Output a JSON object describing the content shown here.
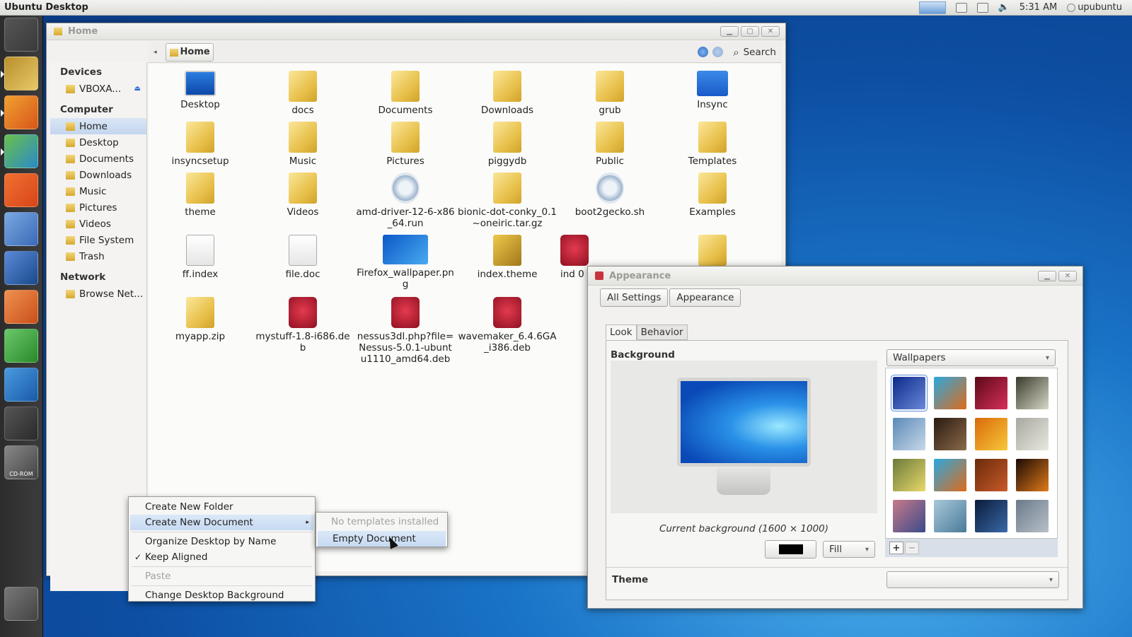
{
  "topbar": {
    "title": "Ubuntu Desktop",
    "time": "5:31 AM",
    "user": "upubuntu"
  },
  "launcher": {
    "icons": [
      "ubuntu-logo-icon",
      "files-icon",
      "firefox-icon",
      "image-viewer-icon",
      "software-center-icon",
      "system-settings-icon",
      "writer-icon",
      "impress-icon",
      "calc-icon",
      "display-icon",
      "workspaces-icon",
      "cdrom-icon",
      "trash-icon"
    ],
    "cdrom_label": "CD-ROM"
  },
  "files": {
    "title": "Home",
    "sidebar": {
      "devices_heading": "Devices",
      "device": "VBOXA...",
      "computer_heading": "Computer",
      "computer_items": [
        "Home",
        "Desktop",
        "Documents",
        "Downloads",
        "Music",
        "Pictures",
        "Videos",
        "File System",
        "Trash"
      ],
      "network_heading": "Network",
      "network_item": "Browse Net..."
    },
    "path": "Home",
    "search": "Search",
    "items": [
      {
        "name": "Desktop",
        "kind": "monitor"
      },
      {
        "name": "docs",
        "kind": "folder"
      },
      {
        "name": "Documents",
        "kind": "folder"
      },
      {
        "name": "Downloads",
        "kind": "folder"
      },
      {
        "name": "grub",
        "kind": "folder"
      },
      {
        "name": "Insync",
        "kind": "insync"
      },
      {
        "name": "insyncsetup",
        "kind": "folder"
      },
      {
        "name": "Music",
        "kind": "folder"
      },
      {
        "name": "Pictures",
        "kind": "folder"
      },
      {
        "name": "piggydb",
        "kind": "folder"
      },
      {
        "name": "Public",
        "kind": "folder"
      },
      {
        "name": "Templates",
        "kind": "folder"
      },
      {
        "name": "theme",
        "kind": "folder"
      },
      {
        "name": "Videos",
        "kind": "folder"
      },
      {
        "name": "amd-driver-12-6-x86_64.run",
        "kind": "gear"
      },
      {
        "name": "bionic-dot-conky_0.1~oneiric.tar.gz",
        "kind": "folder"
      },
      {
        "name": "boot2gecko.sh",
        "kind": "gear"
      },
      {
        "name": "Examples",
        "kind": "folder"
      },
      {
        "name": "ff.index",
        "kind": "file"
      },
      {
        "name": "file.doc",
        "kind": "file"
      },
      {
        "name": "Firefox_wallpaper.png",
        "kind": "img"
      },
      {
        "name": "index.theme",
        "kind": "archive"
      },
      {
        "name": "ind 0",
        "kind": "deb"
      },
      {
        "name": "",
        "kind": "folder"
      },
      {
        "name": "myapp.zip",
        "kind": "folder"
      },
      {
        "name": "mystuff-1.8-i686.deb",
        "kind": "deb"
      },
      {
        "name": "nessus3dl.php?file=Nessus-5.0.1-ubuntu1110_amd64.deb",
        "kind": "deb"
      },
      {
        "name": "wavemaker_6.4.6GA_i386.deb",
        "kind": "deb"
      }
    ]
  },
  "context_menu": {
    "items": [
      "Create New Folder",
      "Create New Document",
      "Organize Desktop by Name",
      "Keep Aligned",
      "Paste",
      "Change Desktop Background"
    ],
    "check": "✓",
    "arrow": "▸",
    "submenu": [
      "No templates installed",
      "Empty Document"
    ]
  },
  "appearance": {
    "title": "Appearance",
    "toolbar": [
      "All Settings",
      "Appearance"
    ],
    "tabs": [
      "Look",
      "Behavior"
    ],
    "background_label": "Background",
    "current_background": "Current background (1600 × 1000)",
    "wallpapers_select": "Wallpapers",
    "fill_select": "Fill",
    "color_button": "#000000",
    "add_label": "+",
    "remove_label": "−",
    "theme_label": "Theme",
    "thumbs": [
      {
        "c1": "#0a2a8a",
        "c2": "#6a88d8"
      },
      {
        "c1": "#2aa8e0",
        "c2": "#e06a1a"
      },
      {
        "c1": "#5a0818",
        "c2": "#d8305a"
      },
      {
        "c1": "#3a3a2a",
        "c2": "#d8d8c8"
      },
      {
        "c1": "#5a8ab8",
        "c2": "#c8d8e8"
      },
      {
        "c1": "#2a1a10",
        "c2": "#8a6a4a"
      },
      {
        "c1": "#d86a0a",
        "c2": "#f8c83a"
      },
      {
        "c1": "#a8a8a0",
        "c2": "#e8e8e0"
      },
      {
        "c1": "#6a7a3a",
        "c2": "#e8d86a"
      },
      {
        "c1": "#2aa8e0",
        "c2": "#e06a1a"
      },
      {
        "c1": "#6a2a0a",
        "c2": "#c85a2a"
      },
      {
        "c1": "#1a0a04",
        "c2": "#e07a1a"
      },
      {
        "c1": "#c87a8a",
        "c2": "#3a4a8a"
      },
      {
        "c1": "#a8c8d8",
        "c2": "#4a7a9a"
      },
      {
        "c1": "#0a1a3a",
        "c2": "#3a6aa8"
      },
      {
        "c1": "#6a7a8a",
        "c2": "#b8c0c8"
      }
    ]
  }
}
